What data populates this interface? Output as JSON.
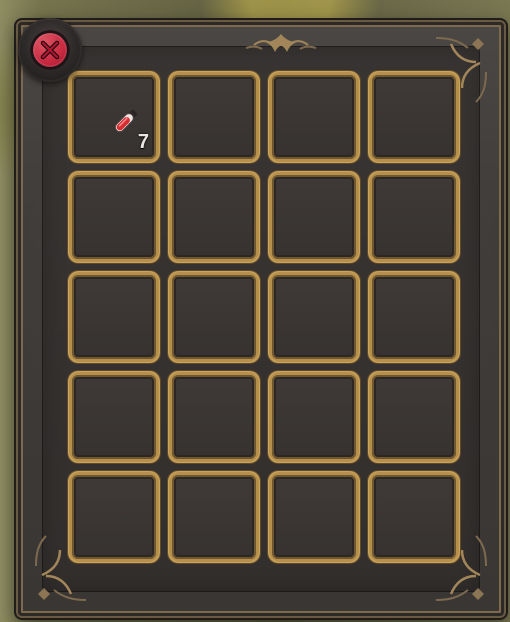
{
  "window": {
    "close_icon": "x-icon"
  },
  "inventory": {
    "slots": [
      {
        "item_icon": "red-vial-icon",
        "count": "7"
      },
      {
        "item_icon": "",
        "count": ""
      },
      {
        "item_icon": "",
        "count": ""
      },
      {
        "item_icon": "",
        "count": ""
      },
      {
        "item_icon": "",
        "count": ""
      },
      {
        "item_icon": "",
        "count": ""
      },
      {
        "item_icon": "",
        "count": ""
      },
      {
        "item_icon": "",
        "count": ""
      },
      {
        "item_icon": "",
        "count": ""
      },
      {
        "item_icon": "",
        "count": ""
      },
      {
        "item_icon": "",
        "count": ""
      },
      {
        "item_icon": "",
        "count": ""
      },
      {
        "item_icon": "",
        "count": ""
      },
      {
        "item_icon": "",
        "count": ""
      },
      {
        "item_icon": "",
        "count": ""
      },
      {
        "item_icon": "",
        "count": ""
      },
      {
        "item_icon": "",
        "count": ""
      },
      {
        "item_icon": "",
        "count": ""
      },
      {
        "item_icon": "",
        "count": ""
      },
      {
        "item_icon": "",
        "count": ""
      }
    ]
  },
  "colors": {
    "frame_gold": "#b68f4b",
    "panel_dark": "#3d3937",
    "close_red": "#c6273f"
  }
}
